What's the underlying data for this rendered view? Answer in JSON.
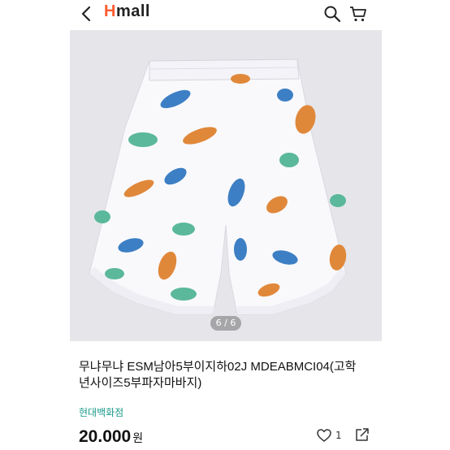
{
  "header": {
    "logo_h": "H",
    "logo_rest": "mall",
    "icons": [
      "back-icon",
      "search-icon",
      "cart-icon"
    ]
  },
  "gallery": {
    "image_counter": "6 / 6"
  },
  "product": {
    "title_line1": "무냐무냐 ESM남아5부이지하02J MDEABMCI04(고학",
    "title_line2": "년사이즈5부파자마바지)",
    "store": "현대백화점",
    "price": "20.000",
    "currency": "원",
    "like_count": "1"
  },
  "colors": {
    "accent": "#1a9a8a",
    "brand": "#ff5b2e"
  }
}
